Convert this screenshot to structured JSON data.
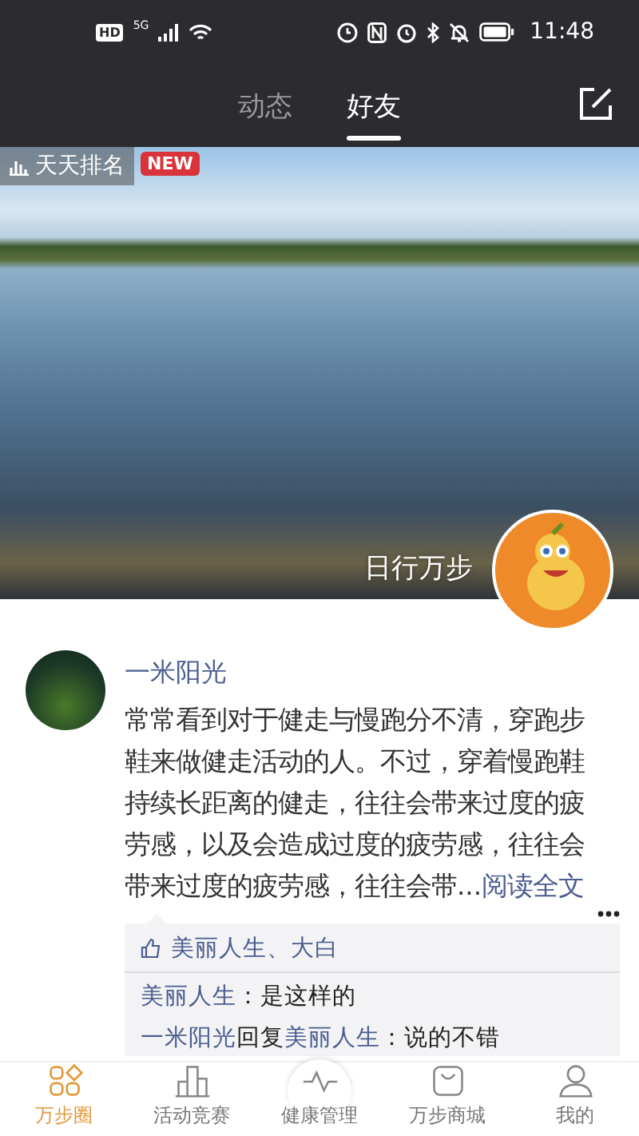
{
  "status_bar": {
    "hd": "HD",
    "network": "5G",
    "time": "11:48"
  },
  "header": {
    "tabs": [
      {
        "label": "动态",
        "selected": false
      },
      {
        "label": "好友",
        "selected": true
      }
    ]
  },
  "banner": {
    "ranking_label": "天天排名",
    "badge": "NEW",
    "slogan": "日行万步"
  },
  "post": {
    "author": "一米阳光",
    "text": "常常看到对于健走与慢跑分不清，穿跑步鞋来做健走活动的人。不过，穿着慢跑鞋持续长距离的健走，往往会带来过度的疲劳感，以及会造成过度的疲劳感，往往会带来过度的疲劳感，往往会带...",
    "read_more": "阅读全文",
    "likes": "美丽人生、大白",
    "comments": [
      {
        "author": "美丽人生",
        "text": "：是这样的"
      },
      {
        "author": "一米阳光",
        "reply_word": "回复",
        "reply_to": "美丽人生",
        "text": "：说的不错"
      }
    ]
  },
  "nav": [
    {
      "label": "万步圈",
      "kind": "circle",
      "selected": true
    },
    {
      "label": "活动竞赛",
      "kind": "contest",
      "selected": false
    },
    {
      "label": "健康管理",
      "kind": "health",
      "selected": false
    },
    {
      "label": "万步商城",
      "kind": "mall",
      "selected": false
    },
    {
      "label": "我的",
      "kind": "me",
      "selected": false
    }
  ]
}
